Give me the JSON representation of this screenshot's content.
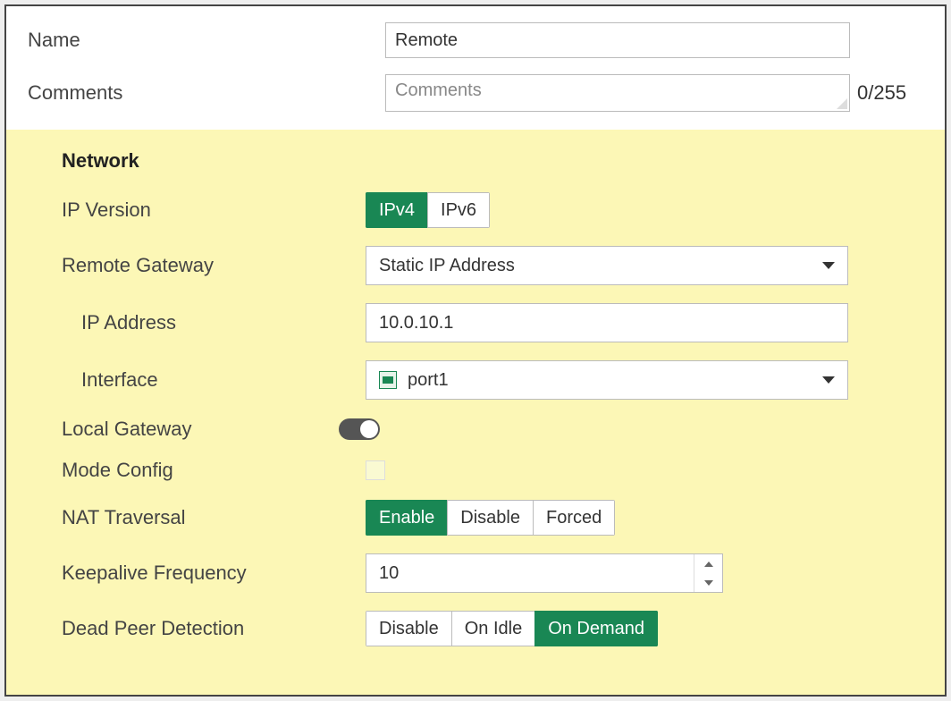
{
  "top": {
    "name_label": "Name",
    "name_value": "Remote",
    "comments_label": "Comments",
    "comments_placeholder": "Comments",
    "comments_counter": "0/255"
  },
  "network": {
    "section_title": "Network",
    "ip_version_label": "IP Version",
    "ip_version_options": {
      "ipv4": "IPv4",
      "ipv6": "IPv6"
    },
    "ip_version_selected": "ipv4",
    "remote_gateway_label": "Remote Gateway",
    "remote_gateway_value": "Static IP Address",
    "ip_address_label": "IP Address",
    "ip_address_value": "10.0.10.1",
    "interface_label": "Interface",
    "interface_value": "port1",
    "local_gateway_label": "Local Gateway",
    "local_gateway_enabled": false,
    "mode_config_label": "Mode Config",
    "mode_config_checked": false,
    "nat_traversal_label": "NAT Traversal",
    "nat_options": {
      "enable": "Enable",
      "disable": "Disable",
      "forced": "Forced"
    },
    "nat_selected": "enable",
    "keepalive_label": "Keepalive Frequency",
    "keepalive_value": "10",
    "dpd_label": "Dead Peer Detection",
    "dpd_options": {
      "disable": "Disable",
      "onidle": "On Idle",
      "ondemand": "On Demand"
    },
    "dpd_selected": "ondemand"
  }
}
